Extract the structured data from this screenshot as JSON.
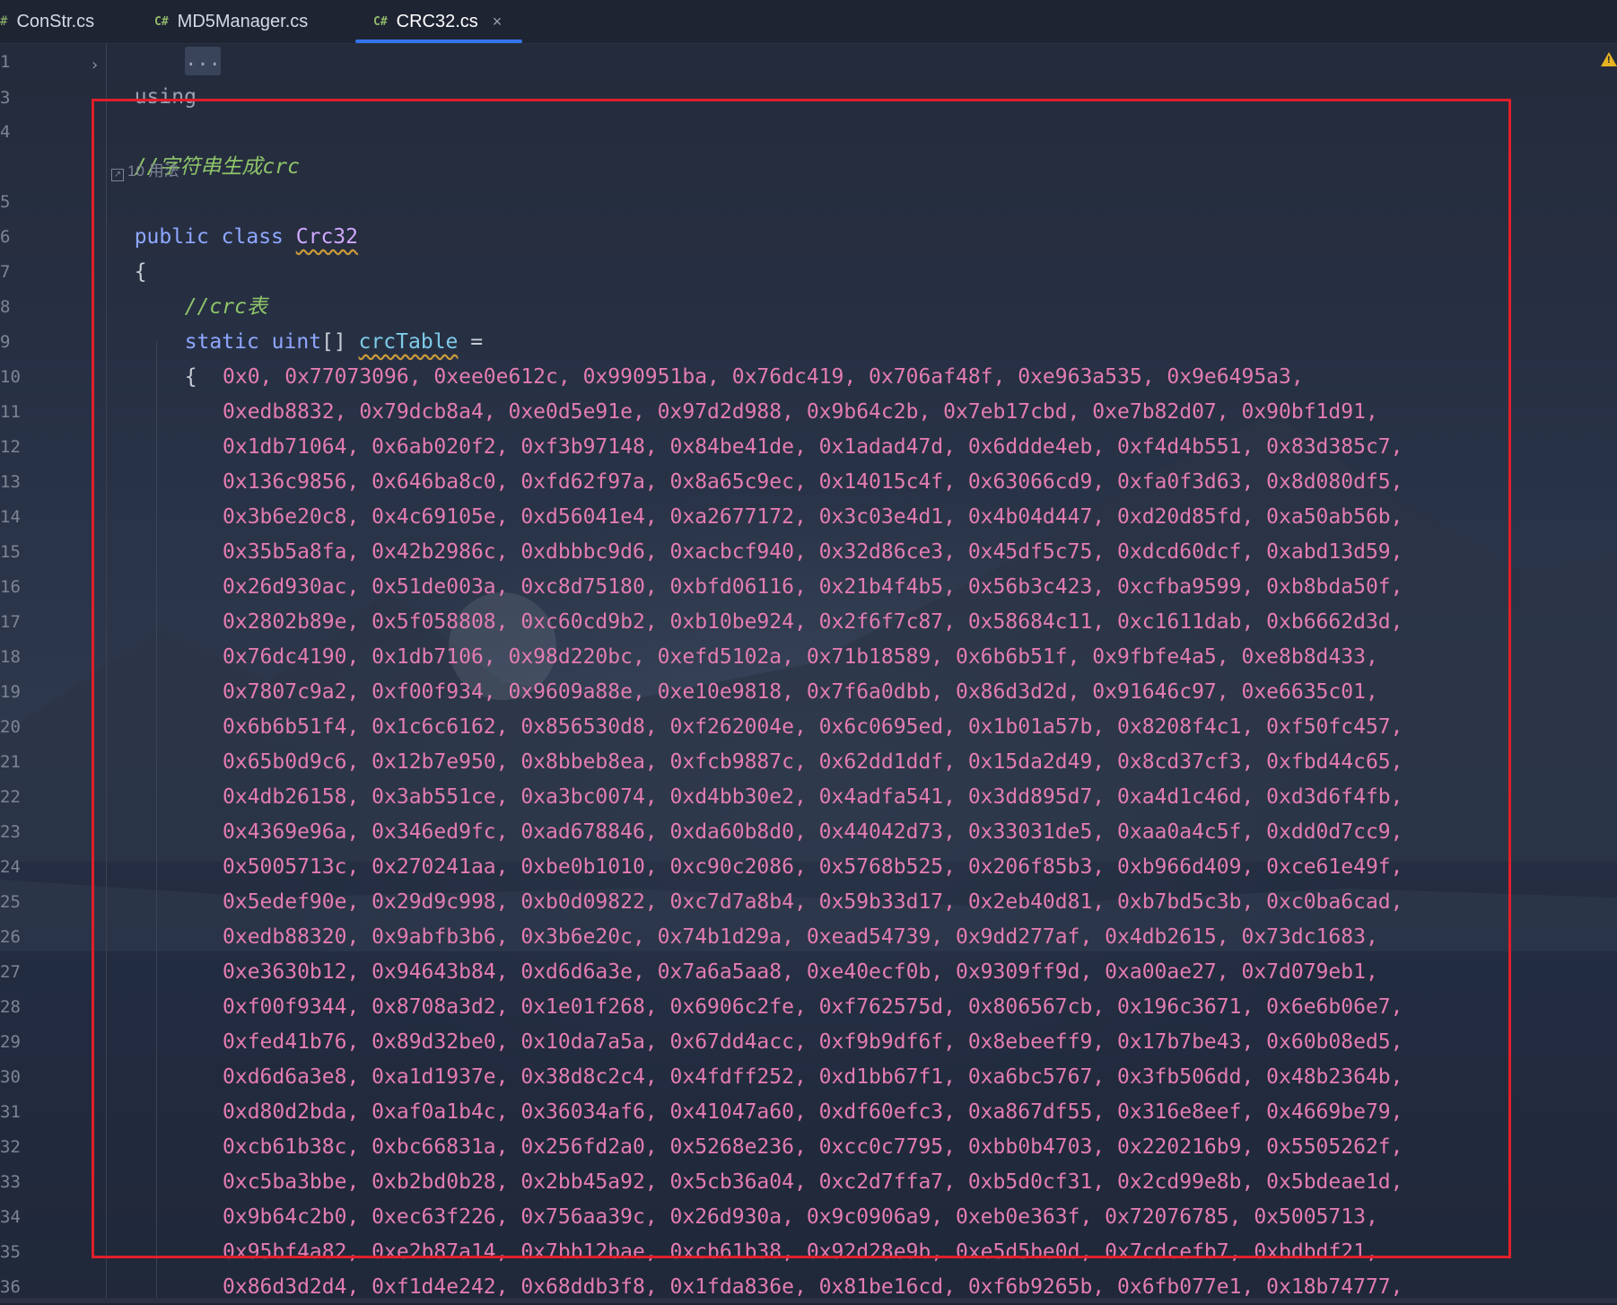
{
  "tabs": [
    {
      "icon": "#",
      "label": "ConStr.cs"
    },
    {
      "icon": "C#",
      "label": "MD5Manager.cs"
    },
    {
      "icon": "C#",
      "label": "CRC32.cs",
      "active": true,
      "close": "×"
    }
  ],
  "header": {
    "using": "using",
    "ellipsis": "..."
  },
  "usages": "10 用法",
  "line_numbers": [
    "1",
    "3",
    "4",
    "5",
    "6",
    "7",
    "8",
    "9",
    "10",
    "11",
    "12",
    "13",
    "14",
    "15",
    "16",
    "17",
    "18",
    "19",
    "20",
    "21",
    "22",
    "23",
    "24",
    "25",
    "26",
    "27",
    "28",
    "29",
    "30",
    "31",
    "32",
    "33",
    "34",
    "35",
    "36"
  ],
  "code": {
    "comment1": "//字符串生成crc",
    "kw_public": "public",
    "kw_class": "class",
    "class_name": "Crc32",
    "brace_open": "{",
    "comment2": "//crc表",
    "kw_static": "static",
    "kw_uint": "uint",
    "brackets": "[]",
    "field_name": "crcTable",
    "equals": "=",
    "brace_open2": "{",
    "rows": [
      "0x0, 0x77073096, 0xee0e612c, 0x990951ba, 0x76dc419, 0x706af48f, 0xe963a535, 0x9e6495a3,",
      "0xedb8832, 0x79dcb8a4, 0xe0d5e91e, 0x97d2d988, 0x9b64c2b, 0x7eb17cbd, 0xe7b82d07, 0x90bf1d91,",
      "0x1db71064, 0x6ab020f2, 0xf3b97148, 0x84be41de, 0x1adad47d, 0x6ddde4eb, 0xf4d4b551, 0x83d385c7,",
      "0x136c9856, 0x646ba8c0, 0xfd62f97a, 0x8a65c9ec, 0x14015c4f, 0x63066cd9, 0xfa0f3d63, 0x8d080df5,",
      "0x3b6e20c8, 0x4c69105e, 0xd56041e4, 0xa2677172, 0x3c03e4d1, 0x4b04d447, 0xd20d85fd, 0xa50ab56b,",
      "0x35b5a8fa, 0x42b2986c, 0xdbbbc9d6, 0xacbcf940, 0x32d86ce3, 0x45df5c75, 0xdcd60dcf, 0xabd13d59,",
      "0x26d930ac, 0x51de003a, 0xc8d75180, 0xbfd06116, 0x21b4f4b5, 0x56b3c423, 0xcfba9599, 0xb8bda50f,",
      "0x2802b89e, 0x5f058808, 0xc60cd9b2, 0xb10be924, 0x2f6f7c87, 0x58684c11, 0xc1611dab, 0xb6662d3d,",
      "0x76dc4190, 0x1db7106, 0x98d220bc, 0xefd5102a, 0x71b18589, 0x6b6b51f, 0x9fbfe4a5, 0xe8b8d433,",
      "0x7807c9a2, 0xf00f934, 0x9609a88e, 0xe10e9818, 0x7f6a0dbb, 0x86d3d2d, 0x91646c97, 0xe6635c01,",
      "0x6b6b51f4, 0x1c6c6162, 0x856530d8, 0xf262004e, 0x6c0695ed, 0x1b01a57b, 0x8208f4c1, 0xf50fc457,",
      "0x65b0d9c6, 0x12b7e950, 0x8bbeb8ea, 0xfcb9887c, 0x62dd1ddf, 0x15da2d49, 0x8cd37cf3, 0xfbd44c65,",
      "0x4db26158, 0x3ab551ce, 0xa3bc0074, 0xd4bb30e2, 0x4adfa541, 0x3dd895d7, 0xa4d1c46d, 0xd3d6f4fb,",
      "0x4369e96a, 0x346ed9fc, 0xad678846, 0xda60b8d0, 0x44042d73, 0x33031de5, 0xaa0a4c5f, 0xdd0d7cc9,",
      "0x5005713c, 0x270241aa, 0xbe0b1010, 0xc90c2086, 0x5768b525, 0x206f85b3, 0xb966d409, 0xce61e49f,",
      "0x5edef90e, 0x29d9c998, 0xb0d09822, 0xc7d7a8b4, 0x59b33d17, 0x2eb40d81, 0xb7bd5c3b, 0xc0ba6cad,",
      "0xedb88320, 0x9abfb3b6, 0x3b6e20c, 0x74b1d29a, 0xead54739, 0x9dd277af, 0x4db2615, 0x73dc1683,",
      "0xe3630b12, 0x94643b84, 0xd6d6a3e, 0x7a6a5aa8, 0xe40ecf0b, 0x9309ff9d, 0xa00ae27, 0x7d079eb1,",
      "0xf00f9344, 0x8708a3d2, 0x1e01f268, 0x6906c2fe, 0xf762575d, 0x806567cb, 0x196c3671, 0x6e6b06e7,",
      "0xfed41b76, 0x89d32be0, 0x10da7a5a, 0x67dd4acc, 0xf9b9df6f, 0x8ebeeff9, 0x17b7be43, 0x60b08ed5,",
      "0xd6d6a3e8, 0xa1d1937e, 0x38d8c2c4, 0x4fdff252, 0xd1bb67f1, 0xa6bc5767, 0x3fb506dd, 0x48b2364b,",
      "0xd80d2bda, 0xaf0a1b4c, 0x36034af6, 0x41047a60, 0xdf60efc3, 0xa867df55, 0x316e8eef, 0x4669be79,",
      "0xcb61b38c, 0xbc66831a, 0x256fd2a0, 0x5268e236, 0xcc0c7795, 0xbb0b4703, 0x220216b9, 0x5505262f,",
      "0xc5ba3bbe, 0xb2bd0b28, 0x2bb45a92, 0x5cb36a04, 0xc2d7ffa7, 0xb5d0cf31, 0x2cd99e8b, 0x5bdeae1d,",
      "0x9b64c2b0, 0xec63f226, 0x756aa39c, 0x26d930a, 0x9c0906a9, 0xeb0e363f, 0x72076785, 0x5005713,",
      "0x95bf4a82, 0xe2b87a14, 0x7bb12bae, 0xcb61b38, 0x92d28e9b, 0xe5d5be0d, 0x7cdcefb7, 0xbdbdf21,",
      "0x86d3d2d4, 0xf1d4e242, 0x68ddb3f8, 0x1fda836e, 0x81be16cd, 0xf6b9265b, 0x6fb077e1, 0x18b74777,"
    ]
  },
  "colors": {
    "keyword": "#8fa7ff",
    "comment": "#8fc46a",
    "number": "#e37cb0",
    "highlight_box": "#e0202a",
    "tab_accent": "#3574f0"
  },
  "icons": [
    "fold-chevron-icon",
    "warning-icon",
    "usages-link-icon",
    "close-icon"
  ]
}
